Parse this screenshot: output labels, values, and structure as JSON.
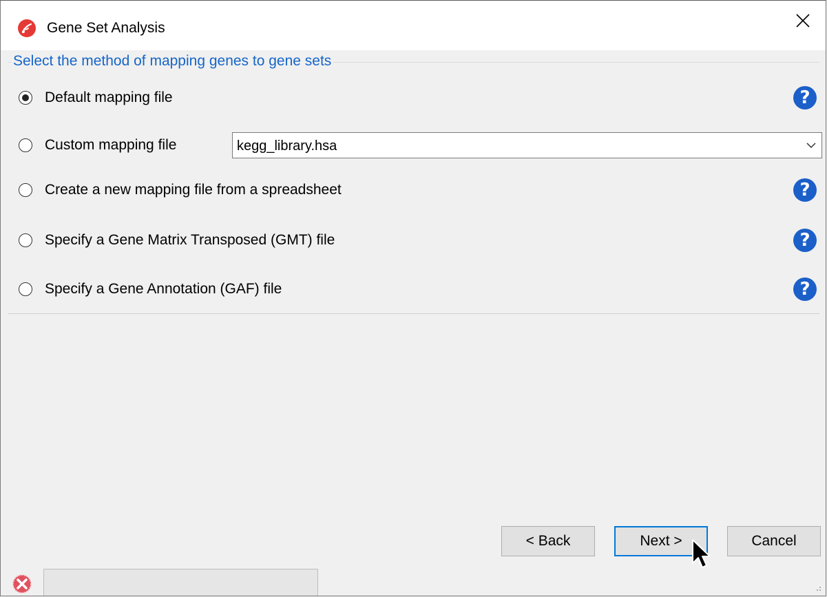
{
  "window": {
    "title": "Gene Set Analysis",
    "close_glyph": "✕"
  },
  "group": {
    "legend": "Select the method of mapping genes to gene sets"
  },
  "options": [
    {
      "label": "Default mapping file",
      "selected": true,
      "has_help": true
    },
    {
      "label": "Custom mapping file",
      "selected": false,
      "has_help": false
    },
    {
      "label": "Create a new mapping file from a spreadsheet",
      "selected": false,
      "has_help": true
    },
    {
      "label": "Specify a Gene Matrix Transposed (GMT) file",
      "selected": false,
      "has_help": true
    },
    {
      "label": "Specify a Gene Annotation (GAF) file",
      "selected": false,
      "has_help": true
    }
  ],
  "custom_file_combo": {
    "value": "kegg_library.hsa"
  },
  "help_glyph": "?",
  "buttons": {
    "back": "< Back",
    "next": "Next >",
    "cancel": "Cancel"
  },
  "icons": {
    "app": "app-logo-icon",
    "help": "help-icon",
    "dropdown": "chevron-down-icon",
    "status": "error-icon",
    "cursor": "mouse-pointer-icon"
  },
  "colors": {
    "accent": "#0078d7",
    "legend": "#1665c8",
    "help": "#1b5fc9",
    "app_icon": "#e53935",
    "status_icon": "#e0525f"
  }
}
